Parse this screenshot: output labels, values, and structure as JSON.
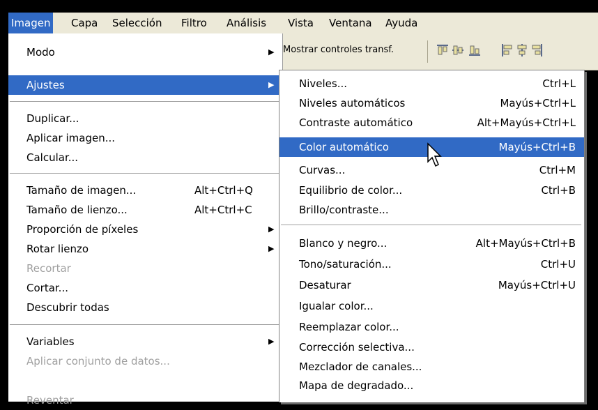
{
  "menubar": {
    "items": [
      "Imagen",
      "Capa",
      "Selección",
      "Filtro",
      "Análisis",
      "Vista",
      "Ventana",
      "Ayuda"
    ],
    "active_index": 0
  },
  "toolbar": {
    "show_transform_controls": "Mostrar controles transf.",
    "icons": [
      "align-top-icon",
      "align-vcenter-icon",
      "align-bottom-icon",
      "align-left-icon",
      "align-hcenter-icon",
      "align-right-icon"
    ]
  },
  "image_menu": {
    "items": [
      {
        "label": "Modo",
        "shortcut": "",
        "submenu": true
      },
      {
        "label": "Ajustes",
        "shortcut": "",
        "submenu": true,
        "highlighted": true
      },
      {
        "label": "Duplicar...",
        "shortcut": ""
      },
      {
        "label": "Aplicar imagen...",
        "shortcut": ""
      },
      {
        "label": "Calcular...",
        "shortcut": ""
      },
      {
        "label": "Tamaño de imagen...",
        "shortcut": "Alt+Ctrl+Q"
      },
      {
        "label": "Tamaño de lienzo...",
        "shortcut": "Alt+Ctrl+C"
      },
      {
        "label": "Proporción de píxeles",
        "shortcut": "",
        "submenu": true
      },
      {
        "label": "Rotar lienzo",
        "shortcut": "",
        "submenu": true
      },
      {
        "label": "Recortar",
        "shortcut": "",
        "disabled": true
      },
      {
        "label": "Cortar...",
        "shortcut": ""
      },
      {
        "label": "Descubrir todas",
        "shortcut": ""
      },
      {
        "label": "Variables",
        "shortcut": "",
        "submenu": true
      },
      {
        "label": "Aplicar conjunto de datos...",
        "shortcut": "",
        "disabled": true
      },
      {
        "label": "Reventar",
        "shortcut": "",
        "disabled": true
      }
    ]
  },
  "adjustments_menu": {
    "items": [
      {
        "label": "Niveles...",
        "shortcut": "Ctrl+L"
      },
      {
        "label": "Niveles automáticos",
        "shortcut": "Mayús+Ctrl+L"
      },
      {
        "label": "Contraste automático",
        "shortcut": "Alt+Mayús+Ctrl+L"
      },
      {
        "label": "Color automático",
        "shortcut": "Mayús+Ctrl+B",
        "highlighted": true
      },
      {
        "label": "Curvas...",
        "shortcut": "Ctrl+M"
      },
      {
        "label": "Equilibrio de color...",
        "shortcut": "Ctrl+B"
      },
      {
        "label": "Brillo/contraste...",
        "shortcut": ""
      },
      {
        "label": "Blanco y negro...",
        "shortcut": "Alt+Mayús+Ctrl+B"
      },
      {
        "label": "Tono/saturación...",
        "shortcut": "Ctrl+U"
      },
      {
        "label": "Desaturar",
        "shortcut": "Mayús+Ctrl+U"
      },
      {
        "label": "Igualar color...",
        "shortcut": ""
      },
      {
        "label": "Reemplazar color...",
        "shortcut": ""
      },
      {
        "label": "Corrección selectiva...",
        "shortcut": ""
      },
      {
        "label": "Mezclador de canales...",
        "shortcut": ""
      },
      {
        "label": "Mapa de degradado...",
        "shortcut": ""
      }
    ]
  },
  "colors": {
    "highlight": "#316ac5",
    "menubar_bg": "#ece9d8",
    "disabled_text": "#a0a0a0"
  }
}
